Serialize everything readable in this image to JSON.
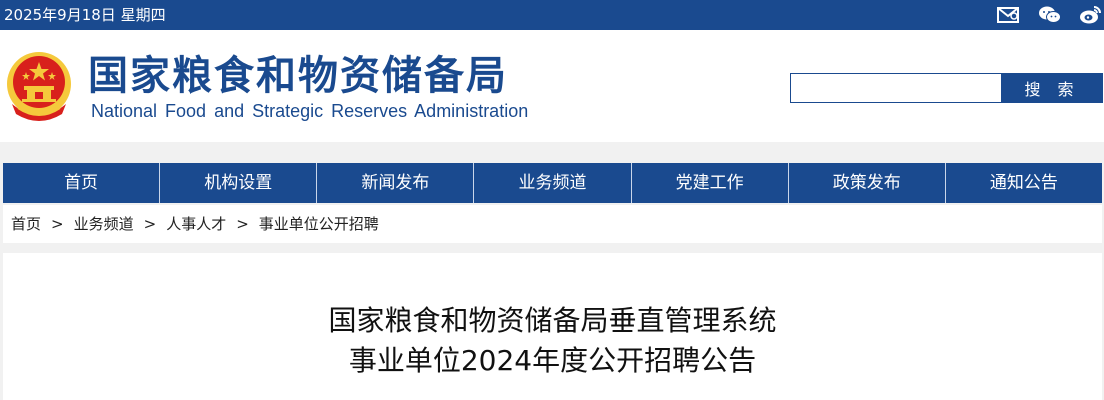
{
  "topbar": {
    "date": "2025年9月18日 星期四",
    "icons": [
      "mail-icon",
      "wechat-icon",
      "weibo-icon"
    ]
  },
  "header": {
    "title_zh": "国家粮食和物资储备局",
    "title_en": "National Food and Strategic Reserves Administration",
    "emblem": "national-emblem"
  },
  "search": {
    "placeholder": "",
    "button_label": "搜 索"
  },
  "nav": {
    "items": [
      {
        "label": "首页"
      },
      {
        "label": "机构设置"
      },
      {
        "label": "新闻发布"
      },
      {
        "label": "业务频道"
      },
      {
        "label": "党建工作"
      },
      {
        "label": "政策发布"
      },
      {
        "label": "通知公告"
      }
    ]
  },
  "breadcrumb": {
    "items": [
      "首页",
      "业务频道",
      "人事人才",
      "事业单位公开招聘"
    ],
    "separator": ">"
  },
  "article": {
    "title_line1": "国家粮食和物资储备局垂直管理系统",
    "title_line2": "事业单位2024年度公开招聘公告"
  },
  "colors": {
    "brand_blue": "#1a4a8f",
    "emblem_red": "#d8201c",
    "emblem_gold": "#f5c93c"
  }
}
